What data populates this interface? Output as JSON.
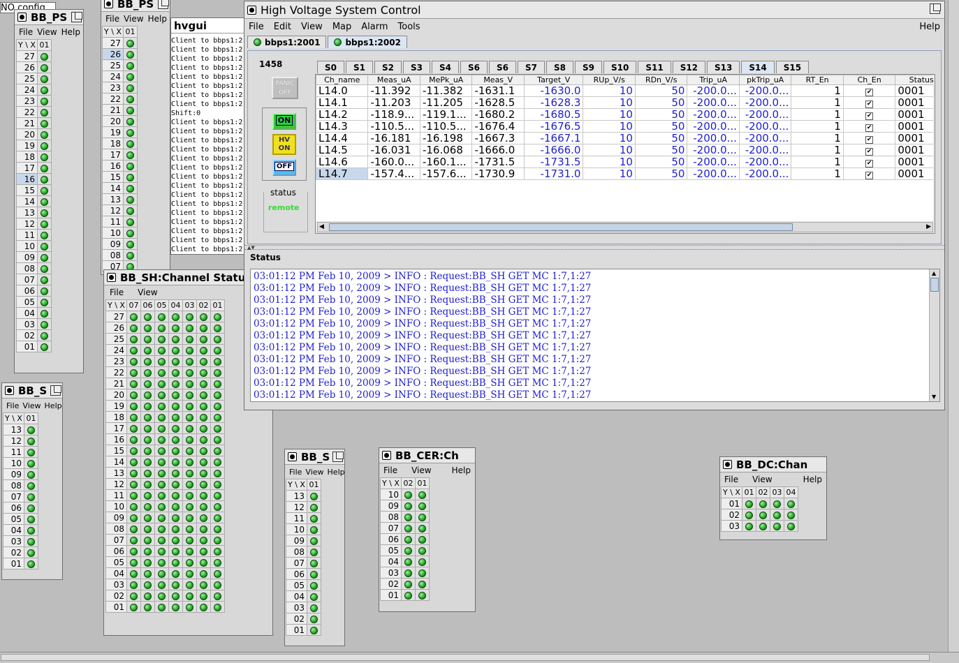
{
  "bb_ps_back": {
    "title": "BB_PS",
    "menu": [
      "File",
      "View",
      "Help"
    ],
    "header": [
      "Y \\ X",
      "01"
    ],
    "rows": [
      "27",
      "26",
      "25",
      "24",
      "23",
      "22",
      "21",
      "20",
      "19",
      "18",
      "17",
      "16",
      "15",
      "14",
      "13",
      "12",
      "11",
      "10",
      "09",
      "08",
      "07"
    ],
    "selected_row": "26"
  },
  "behind_label": "NO config",
  "bb_ps_front": {
    "title": "BB_PS",
    "menu": [
      "File",
      "View",
      "Help"
    ],
    "header": [
      "Y \\ X",
      "01"
    ],
    "rows": [
      "27",
      "26",
      "25",
      "24",
      "23",
      "22",
      "21",
      "20",
      "19",
      "18",
      "17",
      "16",
      "15",
      "14",
      "13",
      "12",
      "11",
      "10",
      "09",
      "08",
      "07",
      "06",
      "05",
      "04",
      "03",
      "02",
      "01"
    ],
    "selected_row": "16"
  },
  "hvgui": {
    "title": "hvgui",
    "lines": [
      "Client to bbps1:2",
      "Client to bbps1:2",
      "Client to bbps1:2",
      "Client to bbps1:2",
      "Client to bbps1:2",
      "Client to bbps1:2",
      "Client to bbps1:2",
      "Client to bbps1:2",
      "Shift:0",
      "Client to bbps1:2",
      "Client to bbps1:2",
      "Client to bbps1:2",
      "Client to bbps1:2",
      "Client to bbps1:2",
      "Client to bbps1:2",
      "Client to bbps1:2",
      "Client to bbps1:2",
      "Client to bbps1:2",
      "Client to bbps1:2",
      "Client to bbps1:2",
      "Client to bbps1:2",
      "Client to bbps1:2",
      "Client to bbps1:2",
      "Client to bbps1:2",
      "Client to bbps1:2"
    ]
  },
  "bb_sh": {
    "title": "BB_SH:Channel Status",
    "menu": [
      "File",
      "View"
    ],
    "header": [
      "Y \\ X",
      "07",
      "06",
      "05",
      "04",
      "03",
      "02",
      "01"
    ],
    "rows": [
      "27",
      "26",
      "25",
      "24",
      "23",
      "22",
      "21",
      "20",
      "19",
      "18",
      "17",
      "16",
      "15",
      "14",
      "13",
      "12",
      "11",
      "10",
      "09",
      "08",
      "07",
      "06",
      "05",
      "04",
      "03",
      "02",
      "01"
    ],
    "cols": 7
  },
  "bb_s_left": {
    "title": "BB_S",
    "menu": [
      "File",
      "View",
      "Help"
    ],
    "header": [
      "Y \\ X",
      "01"
    ],
    "rows": [
      "13",
      "12",
      "11",
      "10",
      "09",
      "08",
      "07",
      "06",
      "05",
      "04",
      "03",
      "02",
      "01"
    ]
  },
  "bb_s_mid": {
    "title": "BB_S",
    "menu": [
      "File",
      "View",
      "Help"
    ],
    "header": [
      "Y \\ X",
      "01"
    ],
    "rows": [
      "13",
      "12",
      "11",
      "10",
      "09",
      "08",
      "07",
      "06",
      "05",
      "04",
      "03",
      "02",
      "01"
    ]
  },
  "bb_cer": {
    "title": "BB_CER:Ch",
    "menu": [
      "File",
      "View",
      "Help"
    ],
    "header": [
      "Y \\ X",
      "02",
      "01"
    ],
    "rows": [
      "10",
      "09",
      "08",
      "07",
      "06",
      "05",
      "04",
      "03",
      "02",
      "01"
    ]
  },
  "bb_dc": {
    "title": "BB_DC:Chan",
    "menu": [
      "File",
      "View",
      "Help"
    ],
    "header": [
      "Y \\ X",
      "01",
      "02",
      "03",
      "04"
    ],
    "rows": [
      "01",
      "02",
      "03"
    ]
  },
  "hv": {
    "title": "High Voltage System Control",
    "menu": [
      "File",
      "Edit",
      "View",
      "Map",
      "Alarm",
      "Tools"
    ],
    "help": "Help",
    "conn_tabs": [
      "bbps1:2001",
      "bbps1:2002"
    ],
    "selected_conn": "bbps1:2002",
    "crate": "1458",
    "panic_label": "PANIC OFF",
    "on_label": "ON",
    "hvon_label": "HV ON",
    "off_label": "OFF",
    "status_label": "status",
    "status_value": "remote",
    "slot_tabs": [
      "S0",
      "S1",
      "S2",
      "S3",
      "S4",
      "S6",
      "S6",
      "S7",
      "S8",
      "S9",
      "S10",
      "S11",
      "S12",
      "S13",
      "S14",
      "S15"
    ],
    "selected_slot": "S14",
    "columns": [
      "Ch_name",
      "Meas_uA",
      "MePk_uA",
      "Meas_V",
      "Target_V",
      "RUp_V/s",
      "RDn_V/s",
      "Trip_uA",
      "pkTrip_uA",
      "RT_En",
      "Ch_En",
      "Status"
    ],
    "rows": [
      [
        "L14.0",
        "-11.392",
        "-11.382",
        "-1631.1",
        "-1630.0",
        "10",
        "50",
        "-200.0...",
        "-200.0...",
        "1",
        "✔",
        "0001"
      ],
      [
        "L14.1",
        "-11.203",
        "-11.205",
        "-1628.5",
        "-1628.3",
        "10",
        "50",
        "-200.0...",
        "-200.0...",
        "1",
        "✔",
        "0001"
      ],
      [
        "L14.2",
        "-118.9...",
        "-119.1...",
        "-1680.2",
        "-1680.5",
        "10",
        "50",
        "-200.0...",
        "-200.0...",
        "1",
        "✔",
        "0001"
      ],
      [
        "L14.3",
        "-110.5...",
        "-110.5...",
        "-1676.4",
        "-1676.5",
        "10",
        "50",
        "-200.0...",
        "-200.0...",
        "1",
        "✔",
        "0001"
      ],
      [
        "L14.4",
        "-16.181",
        "-16.198",
        "-1667.3",
        "-1667.1",
        "10",
        "50",
        "-200.0...",
        "-200.0...",
        "1",
        "✔",
        "0001"
      ],
      [
        "L14.5",
        "-16.031",
        "-16.068",
        "-1666.0",
        "-1666.0",
        "10",
        "50",
        "-200.0...",
        "-200.0...",
        "1",
        "✔",
        "0001"
      ],
      [
        "L14.6",
        "-160.0...",
        "-160.1...",
        "-1731.5",
        "-1731.5",
        "10",
        "50",
        "-200.0...",
        "-200.0...",
        "1",
        "✔",
        "0001"
      ],
      [
        "L14.7",
        "-157.4...",
        "-157.6...",
        "-1730.9",
        "-1731.0",
        "10",
        "50",
        "-200.0...",
        "-200.0...",
        "1",
        "✔",
        "0001"
      ]
    ],
    "status_title": "Status",
    "log": [
      "03:01:12 PM Feb 10, 2009 > INFO : Request:BB_SH GET MC 1:7,1:27",
      "03:01:12 PM Feb 10, 2009 > INFO : Request:BB_SH GET MC 1:7,1:27",
      "03:01:12 PM Feb 10, 2009 > INFO : Request:BB_SH GET MC 1:7,1:27",
      "03:01:12 PM Feb 10, 2009 > INFO : Request:BB_SH GET MC 1:7,1:27",
      "03:01:12 PM Feb 10, 2009 > INFO : Request:BB_SH GET MC 1:7,1:27",
      "03:01:12 PM Feb 10, 2009 > INFO : Request:BB_SH GET MC 1:7,1:27",
      "03:01:12 PM Feb 10, 2009 > INFO : Request:BB_SH GET MC 1:7,1:27",
      "03:01:12 PM Feb 10, 2009 > INFO : Request:BB_SH GET MC 1:7,1:27",
      "03:01:12 PM Feb 10, 2009 > INFO : Request:BB_SH GET MC 1:7,1:27",
      "03:01:12 PM Feb 10, 2009 > INFO : Request:BB_SH GET MC 1:7,1:27",
      "03:01:12 PM Feb 10, 2009 > INFO : Request:BB_SH GET MC 1:7,1:27"
    ]
  },
  "colors": {
    "led": "#1fa31f",
    "log_text": "#2020d0",
    "remote": "#33dd33",
    "selected_tab": "#dce6f3"
  }
}
